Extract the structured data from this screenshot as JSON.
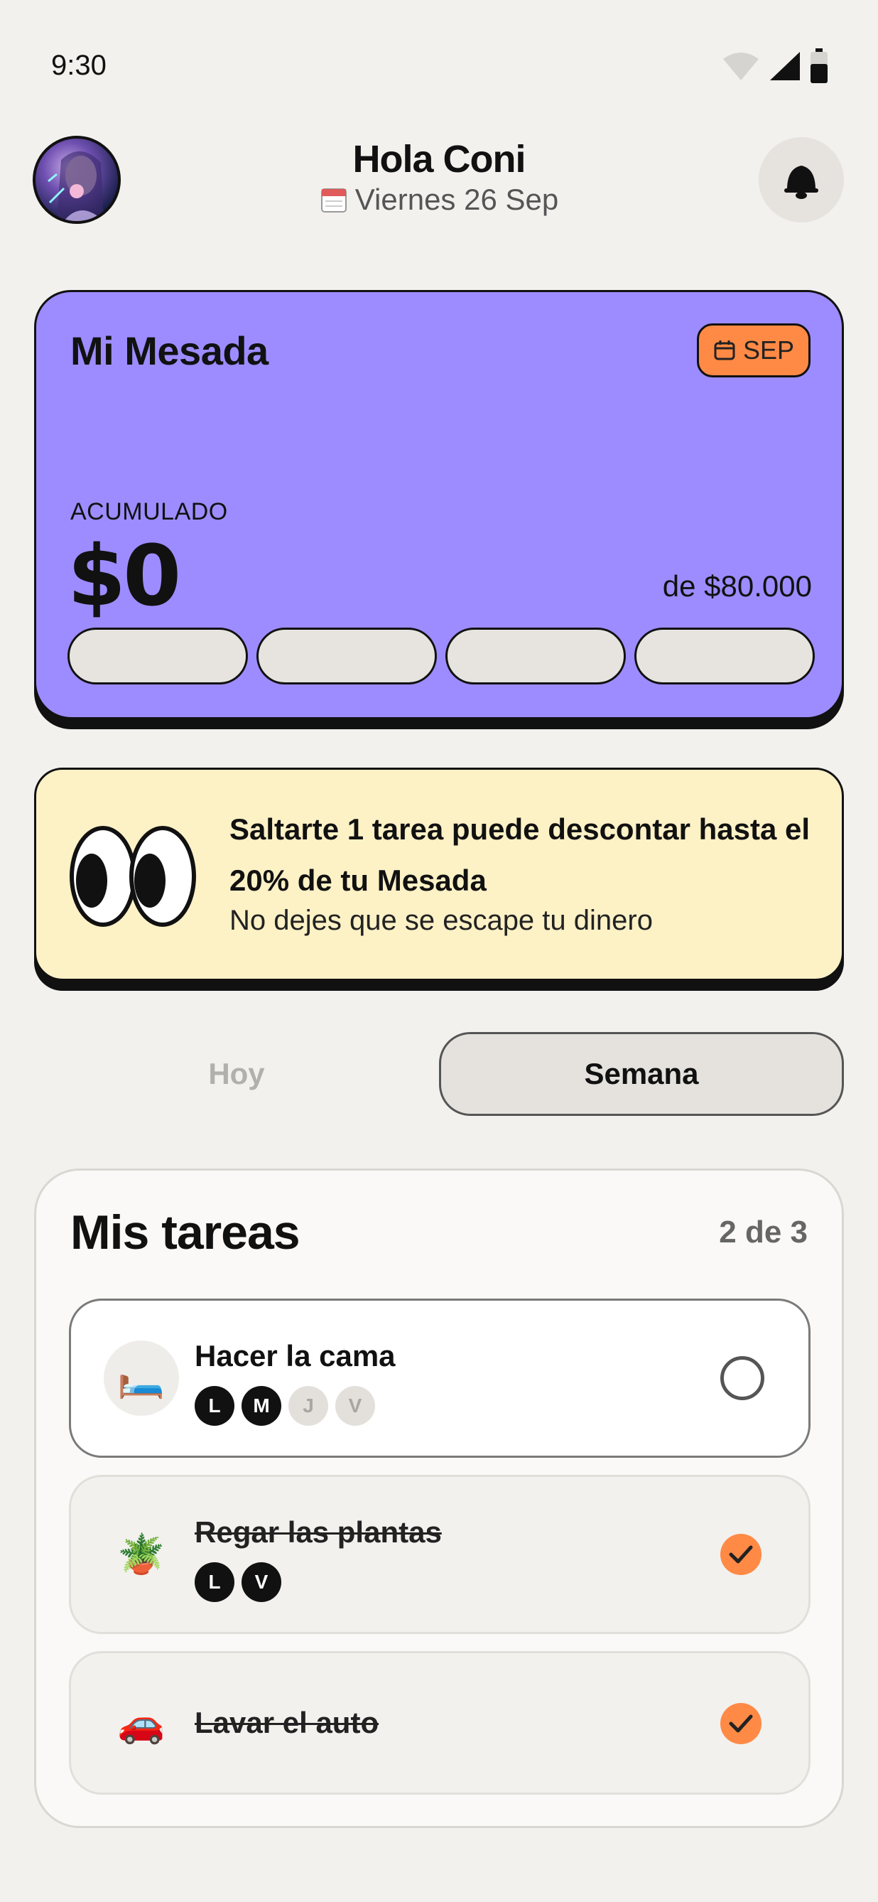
{
  "status_bar": {
    "time": "9:30"
  },
  "header": {
    "greeting": "Hola Coni",
    "date": "Viernes 26 Sep"
  },
  "mesada": {
    "title": "Mi Mesada",
    "month_badge": "SEP",
    "accumulated_label": "ACUMULADO",
    "accumulated_amount": "$0",
    "goal": "de $80.000",
    "progress_segments_filled": 0,
    "progress_segments_total": 4
  },
  "warning": {
    "title": "Saltarte 1 tarea puede descontar hasta el 20% de tu Mesada",
    "subtitle": "No dejes que se escape tu dinero"
  },
  "segment": {
    "today": "Hoy",
    "week": "Semana",
    "selected": "week"
  },
  "tasks": {
    "title": "Mis tareas",
    "count": "2 de 3",
    "items": [
      {
        "name": "Hacer la cama",
        "emoji": "🛏️",
        "icon": "bed-icon",
        "done": false,
        "days": [
          {
            "label": "L",
            "on": true
          },
          {
            "label": "M",
            "on": true
          },
          {
            "label": "J",
            "on": false
          },
          {
            "label": "V",
            "on": false
          }
        ]
      },
      {
        "name": "Regar las plantas",
        "emoji": "🪴",
        "icon": "potted-plant-icon",
        "done": true,
        "days": [
          {
            "label": "L",
            "on": true
          },
          {
            "label": "V",
            "on": true
          }
        ]
      },
      {
        "name": "Lavar el auto",
        "emoji": "🚗",
        "icon": "car-icon",
        "done": true,
        "days": []
      }
    ]
  },
  "colors": {
    "background": "#f2f1ee",
    "mesada_card": "#9d8cff",
    "accent_orange": "#ff8a45",
    "warning_card": "#fdf1c6"
  }
}
